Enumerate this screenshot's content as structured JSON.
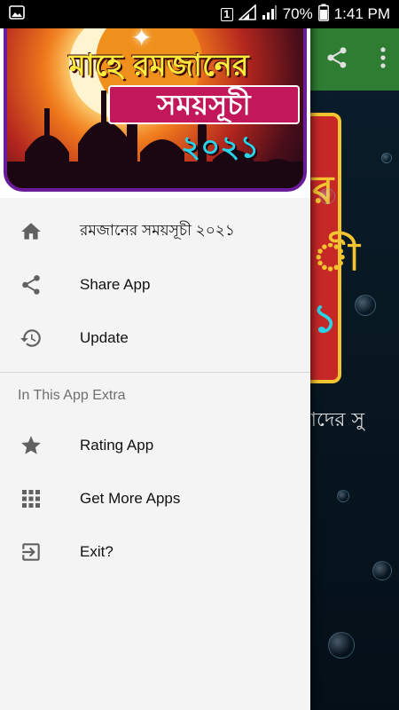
{
  "status_bar": {
    "sim": "1",
    "battery": "70%",
    "time": "1:41 PM"
  },
  "drawer": {
    "banner": {
      "title_line1": "মাহে রমজানের",
      "title_line2": "সময়সূচী",
      "year": "২০২১"
    },
    "items": [
      {
        "label": "রমজানের সময়সূচী ২০২১",
        "icon": "home-icon"
      },
      {
        "label": "Share App",
        "icon": "share-icon"
      },
      {
        "label": "Update",
        "icon": "history-icon"
      }
    ],
    "section_title": "In This App Extra",
    "extra_items": [
      {
        "label": "Rating App",
        "icon": "star-icon"
      },
      {
        "label": "Get More Apps",
        "icon": "apps-grid-icon"
      },
      {
        "label": "Exit?",
        "icon": "exit-icon"
      }
    ]
  },
  "background": {
    "toolbar_color": "#2e7d32",
    "card_glyph_1": "র",
    "card_glyph_2": "ী",
    "card_glyph_3": "১",
    "marquee_text": "াদের সু"
  },
  "colors": {
    "drawer_bg": "#f4f4f4",
    "icon": "#616161",
    "banner_border": "#6a1b9a"
  }
}
